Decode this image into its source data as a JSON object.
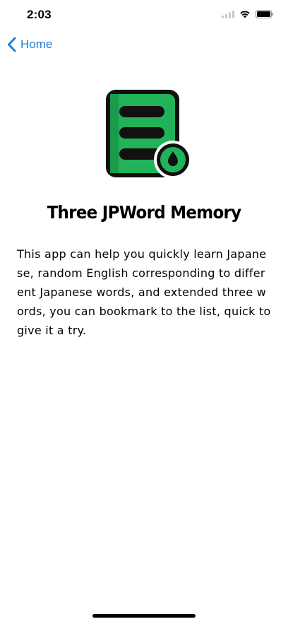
{
  "status_bar": {
    "time": "2:03",
    "icons": [
      "cellular-signal-icon",
      "wifi-icon",
      "battery-icon"
    ]
  },
  "nav": {
    "back_label": "Home",
    "accent_color": "#1b7fe0"
  },
  "app": {
    "icon": "document-list-with-drop-icon",
    "icon_color": "#22b35a",
    "title": "Three JPWord Memory",
    "description": "This app can help you quickly learn Japanese, random English corresponding to different Japanese words, and extended three words, you can bookmark to the list, quick to give it a try."
  }
}
